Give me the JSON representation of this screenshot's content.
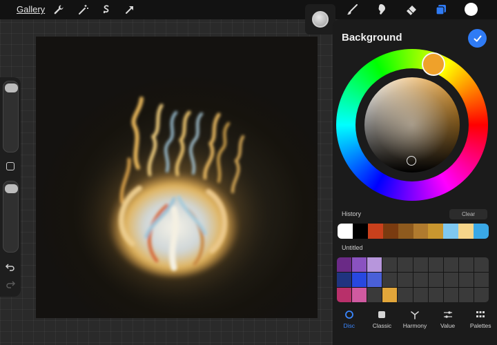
{
  "topbar": {
    "gallery_label": "Gallery",
    "left_tools": [
      "wrench-icon",
      "magic-wand-icon",
      "selection-icon",
      "transform-arrow-icon"
    ],
    "right_tools": [
      "brush-icon",
      "smudge-icon",
      "eraser-icon",
      "layers-icon"
    ],
    "current_color": "#ffffff",
    "accent": "#2f7bf5"
  },
  "color_panel": {
    "title": "Background",
    "selected_hue": "#efa12a",
    "history_label": "History",
    "clear_label": "Clear",
    "history_swatches": [
      "#ffffff",
      "#000000",
      "#c9401c",
      "#7a3b10",
      "#8e5a1e",
      "#b07a2e",
      "#c9962f",
      "#7fc8f0",
      "#f6d58a",
      "#3aa8e6"
    ],
    "palette_label": "Untitled",
    "palette_swatches": [
      "#6a2a86",
      "#8a52c0",
      "#b796dc",
      "#3a3a3a",
      "#3a3a3a",
      "#3a3a3a",
      "#3a3a3a",
      "#3a3a3a",
      "#3a3a3a",
      "#3a3a3a",
      "#203480",
      "#2848e0",
      "#4a60d8",
      "#3a3a3a",
      "#3a3a3a",
      "#3a3a3a",
      "#3a3a3a",
      "#3a3a3a",
      "#3a3a3a",
      "#3a3a3a",
      "#b8306a",
      "#d05aa0",
      "#3a3a3a",
      "#e2a63a",
      "#3a3a3a",
      "#3a3a3a",
      "#3a3a3a",
      "#3a3a3a",
      "#3a3a3a",
      "#3a3a3a"
    ],
    "tabs": [
      {
        "label": "Disc",
        "icon": "disc-icon",
        "active": true
      },
      {
        "label": "Classic",
        "icon": "square-icon",
        "active": false
      },
      {
        "label": "Harmony",
        "icon": "harmony-icon",
        "active": false
      },
      {
        "label": "Value",
        "icon": "sliders-icon",
        "active": false
      },
      {
        "label": "Palettes",
        "icon": "grid-icon",
        "active": false
      }
    ]
  }
}
